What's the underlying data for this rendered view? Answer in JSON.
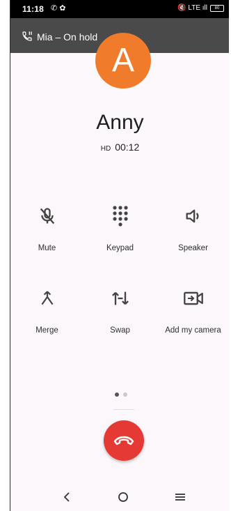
{
  "status_bar": {
    "time": "11:18",
    "left_icons": "✆ ✿",
    "right_icons": "🔇 LTE ıll",
    "battery": "80"
  },
  "hold_banner": {
    "text": "Mia – On hold"
  },
  "caller": {
    "initial": "A",
    "name": "Anny",
    "timer": "00:12",
    "hd_badge": "HD"
  },
  "controls": [
    {
      "label": "Mute",
      "icon": "mic-off-icon"
    },
    {
      "label": "Keypad",
      "icon": "keypad-icon"
    },
    {
      "label": "Speaker",
      "icon": "speaker-icon"
    },
    {
      "label": "Merge",
      "icon": "merge-icon"
    },
    {
      "label": "Swap",
      "icon": "swap-icon"
    },
    {
      "label": "Add my camera",
      "icon": "video-camera-icon"
    }
  ],
  "pager": {
    "pages": 2,
    "current": 1
  },
  "colors": {
    "avatar": "#f07c2b",
    "end_call": "#e53935",
    "banner": "#4a4a4a",
    "background": "#fbf7fa"
  },
  "nav": {
    "back": "‹",
    "home": "○",
    "recents": "≡"
  }
}
